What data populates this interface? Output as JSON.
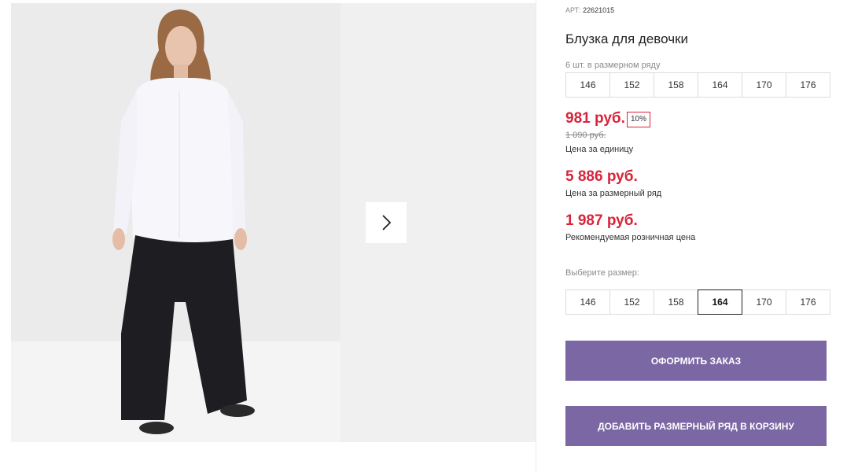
{
  "product": {
    "article_label": "АРТ:",
    "article_value": "22621015",
    "title": "Блузка для девочки",
    "row_label": "6 шт. в размерном ряду",
    "row_sizes": [
      "146",
      "152",
      "158",
      "164",
      "170",
      "176"
    ],
    "price_unit": "981 руб.",
    "discount": "10%",
    "old_price": "1 090 руб.",
    "price_unit_caption": "Цена за единицу",
    "price_row": "5 886 руб.",
    "price_row_caption": "Цена за размерный ряд",
    "price_rrp": "1 987 руб.",
    "price_rrp_caption": "Рекомендуемая розничная цена",
    "choose_size_label": "Выберите размер:",
    "pick_sizes": [
      "146",
      "152",
      "158",
      "164",
      "170",
      "176"
    ],
    "selected_size": "164"
  },
  "buttons": {
    "order": "ОФОРМИТЬ ЗАКАЗ",
    "add_row_to_cart": "ДОБАВИТЬ РАЗМЕРНЫЙ РЯД В КОРЗИНУ"
  },
  "icons": {
    "next": "chevron-right-icon"
  },
  "colors": {
    "price_red": "#d8243a",
    "button_purple": "#7b67a4"
  }
}
